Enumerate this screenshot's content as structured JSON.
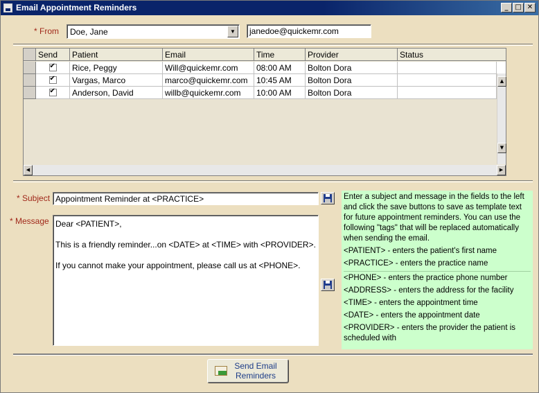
{
  "window": {
    "title": "Email Appointment Reminders",
    "minimize": "_",
    "maximize": "□",
    "close": "✕"
  },
  "from": {
    "label": "* From",
    "selected": "Doe, Jane",
    "email": "janedoe@quickemr.com"
  },
  "grid": {
    "columns": [
      "Send",
      "Patient",
      "Email",
      "Time",
      "Provider",
      "Status"
    ],
    "rows": [
      {
        "send": true,
        "patient": "Rice, Peggy",
        "email": "Will@quickemr.com",
        "time": "08:00 AM",
        "provider": "Bolton Dora",
        "status": ""
      },
      {
        "send": true,
        "patient": "Vargas, Marco",
        "email": "marco@quickemr.com",
        "time": "10:45 AM",
        "provider": "Bolton Dora",
        "status": ""
      },
      {
        "send": true,
        "patient": "Anderson, David",
        "email": "willb@quickemr.com",
        "time": "10:00 AM",
        "provider": "Bolton Dora",
        "status": ""
      }
    ]
  },
  "subject": {
    "label": "* Subject",
    "value": "Appointment Reminder at <PRACTICE>"
  },
  "message": {
    "label": "* Message",
    "lines": [
      "Dear <PATIENT>,",
      "",
      "This is a friendly reminder...on <DATE> at <TIME> with <PROVIDER>.",
      "",
      "If you cannot make your appointment, please call us at <PHONE>."
    ]
  },
  "help": {
    "intro": "Enter a subject and message in the fields to the left and click the save buttons to save as template text for future appointment reminders. You can use the following \"tags\" that will be replaced automatically when sending the email.",
    "tags": [
      "<PATIENT> - enters the patient's first name",
      "<PRACTICE> - enters the practice name",
      "<PHONE> - enters the practice phone number",
      "<ADDRESS> - enters the address for the facility",
      "<TIME> - enters the appointment time",
      "<DATE> - enters the appointment date",
      "<PROVIDER> - enters the provider the patient is scheduled with"
    ]
  },
  "send_button": {
    "line1": "Send Email",
    "line2": "Reminders"
  }
}
